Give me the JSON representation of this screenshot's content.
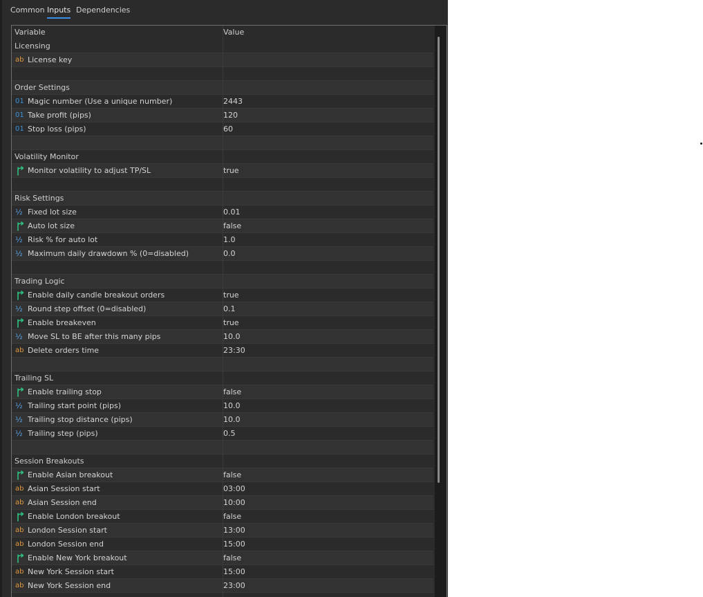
{
  "tabs": [
    {
      "label": "Common"
    },
    {
      "label": "Inputs"
    },
    {
      "label": "Dependencies"
    }
  ],
  "active_tab": "Inputs",
  "grid": {
    "header": {
      "variable": "Variable",
      "value": "Value"
    },
    "rows": [
      {
        "type": "group",
        "label": "Licensing"
      },
      {
        "type": "param",
        "icon": "string",
        "icon_text": "ab",
        "label": "License key",
        "value": ""
      },
      {
        "type": "blank"
      },
      {
        "type": "group",
        "label": "Order Settings"
      },
      {
        "type": "param",
        "icon": "int",
        "icon_text": "01",
        "label": "Magic number (Use a unique number)",
        "value": "2443"
      },
      {
        "type": "param",
        "icon": "int",
        "icon_text": "01",
        "label": "Take profit (pips)",
        "value": "120"
      },
      {
        "type": "param",
        "icon": "int",
        "icon_text": "01",
        "label": "Stop loss (pips)",
        "value": "60"
      },
      {
        "type": "blank"
      },
      {
        "type": "group",
        "label": "Volatility Monitor"
      },
      {
        "type": "param",
        "icon": "bool",
        "label": "Monitor volatility to adjust TP/SL",
        "value": "true"
      },
      {
        "type": "blank"
      },
      {
        "type": "group",
        "label": "Risk Settings"
      },
      {
        "type": "param",
        "icon": "double",
        "icon_text": "½",
        "label": "Fixed lot size",
        "value": "0.01"
      },
      {
        "type": "param",
        "icon": "bool",
        "label": "Auto lot size",
        "value": "false"
      },
      {
        "type": "param",
        "icon": "double",
        "icon_text": "½",
        "label": "Risk % for auto lot",
        "value": "1.0"
      },
      {
        "type": "param",
        "icon": "double",
        "icon_text": "½",
        "label": "Maximum daily drawdown % (0=disabled)",
        "value": "0.0"
      },
      {
        "type": "blank"
      },
      {
        "type": "group",
        "label": "Trading Logic"
      },
      {
        "type": "param",
        "icon": "bool",
        "label": "Enable daily candle breakout orders",
        "value": "true"
      },
      {
        "type": "param",
        "icon": "double",
        "icon_text": "½",
        "label": "Round step offset (0=disabled)",
        "value": "0.1"
      },
      {
        "type": "param",
        "icon": "bool",
        "label": "Enable breakeven",
        "value": "true"
      },
      {
        "type": "param",
        "icon": "double",
        "icon_text": "½",
        "label": "Move SL to BE after this many pips",
        "value": "10.0"
      },
      {
        "type": "param",
        "icon": "string",
        "icon_text": "ab",
        "label": "Delete orders time",
        "value": "23:30"
      },
      {
        "type": "blank"
      },
      {
        "type": "group",
        "label": "Trailing SL"
      },
      {
        "type": "param",
        "icon": "bool",
        "label": "Enable trailing stop",
        "value": "false"
      },
      {
        "type": "param",
        "icon": "double",
        "icon_text": "½",
        "label": "Trailing start point (pips)",
        "value": "10.0"
      },
      {
        "type": "param",
        "icon": "double",
        "icon_text": "½",
        "label": "Trailing stop distance (pips)",
        "value": "10.0"
      },
      {
        "type": "param",
        "icon": "double",
        "icon_text": "½",
        "label": "Trailing step (pips)",
        "value": "0.5"
      },
      {
        "type": "blank"
      },
      {
        "type": "group",
        "label": "Session Breakouts"
      },
      {
        "type": "param",
        "icon": "bool",
        "label": "Enable Asian breakout",
        "value": "false"
      },
      {
        "type": "param",
        "icon": "string",
        "icon_text": "ab",
        "label": "Asian Session start",
        "value": "03:00"
      },
      {
        "type": "param",
        "icon": "string",
        "icon_text": "ab",
        "label": "Asian Session end",
        "value": "10:00"
      },
      {
        "type": "param",
        "icon": "bool",
        "label": "Enable London breakout",
        "value": "false"
      },
      {
        "type": "param",
        "icon": "string",
        "icon_text": "ab",
        "label": "London Session start",
        "value": "13:00"
      },
      {
        "type": "param",
        "icon": "string",
        "icon_text": "ab",
        "label": "London Session end",
        "value": "15:00"
      },
      {
        "type": "param",
        "icon": "bool",
        "label": "Enable New York breakout",
        "value": "false"
      },
      {
        "type": "param",
        "icon": "string",
        "icon_text": "ab",
        "label": "New York Session start",
        "value": "15:00"
      },
      {
        "type": "param",
        "icon": "string",
        "icon_text": "ab",
        "label": "New York Session end",
        "value": "23:00"
      }
    ]
  },
  "colors": {
    "background": "#2b2b2b",
    "alt_row": "#323232",
    "accent": "#3c8ee6",
    "string_icon": "#e09a3c",
    "int_icon": "#3a95e0",
    "bool_icon": "#2fbf7f"
  }
}
